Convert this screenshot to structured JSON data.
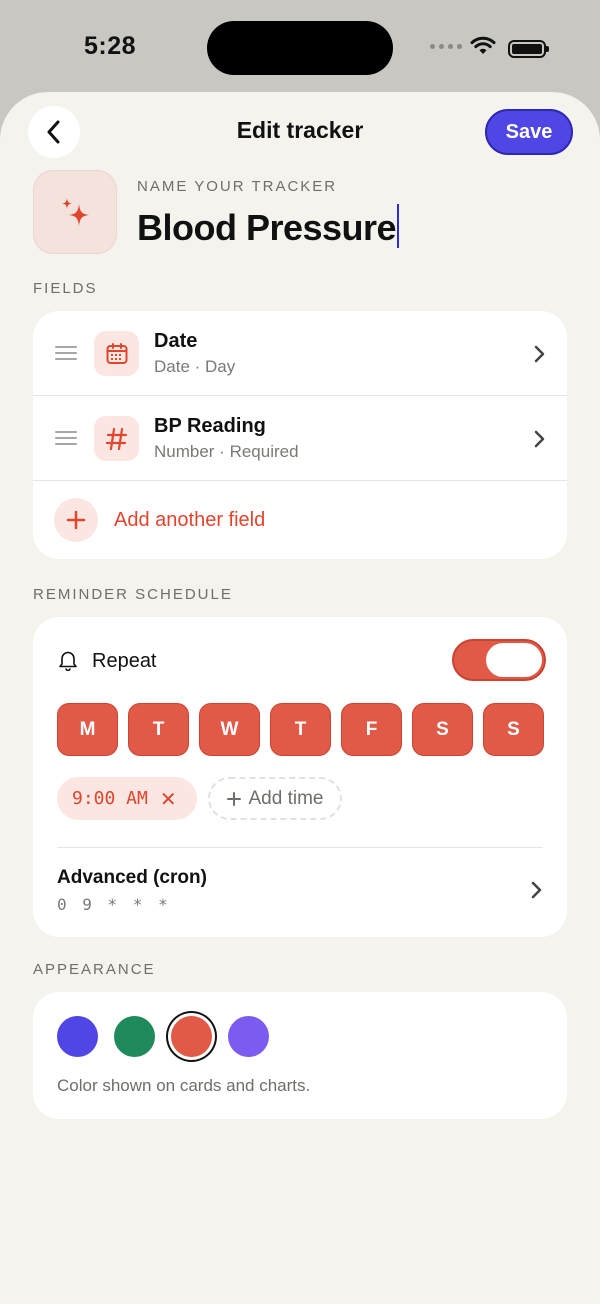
{
  "status_bar": {
    "time": "5:28"
  },
  "header": {
    "title": "Edit tracker",
    "save_label": "Save"
  },
  "tracker": {
    "name_label": "NAME YOUR TRACKER",
    "name_value": "Blood Pressure"
  },
  "fields_section": {
    "label": "FIELDS",
    "items": [
      {
        "name": "Date",
        "sub": "Date · Day",
        "icon": "calendar-icon"
      },
      {
        "name": "BP Reading",
        "sub": "Number · Required",
        "icon": "hash-icon"
      }
    ],
    "add_label": "Add another field"
  },
  "reminder": {
    "label": "REMINDER SCHEDULE",
    "repeat_label": "Repeat",
    "repeat_on": true,
    "days": [
      "M",
      "T",
      "W",
      "T",
      "F",
      "S",
      "S"
    ],
    "time_value": "9:00 AM",
    "add_time_label": "Add time",
    "advanced_label": "Advanced (cron)",
    "cron_value": "0 9 * * *"
  },
  "appearance": {
    "label": "APPEARANCE",
    "colors": [
      "#4f46e5",
      "#1f8a5b",
      "#e05a47",
      "#7c5cf0"
    ],
    "selected_color": "#e05a47",
    "note": "Color shown on cards and charts."
  },
  "accent": "#e0452e",
  "brand": "#4f46e5"
}
